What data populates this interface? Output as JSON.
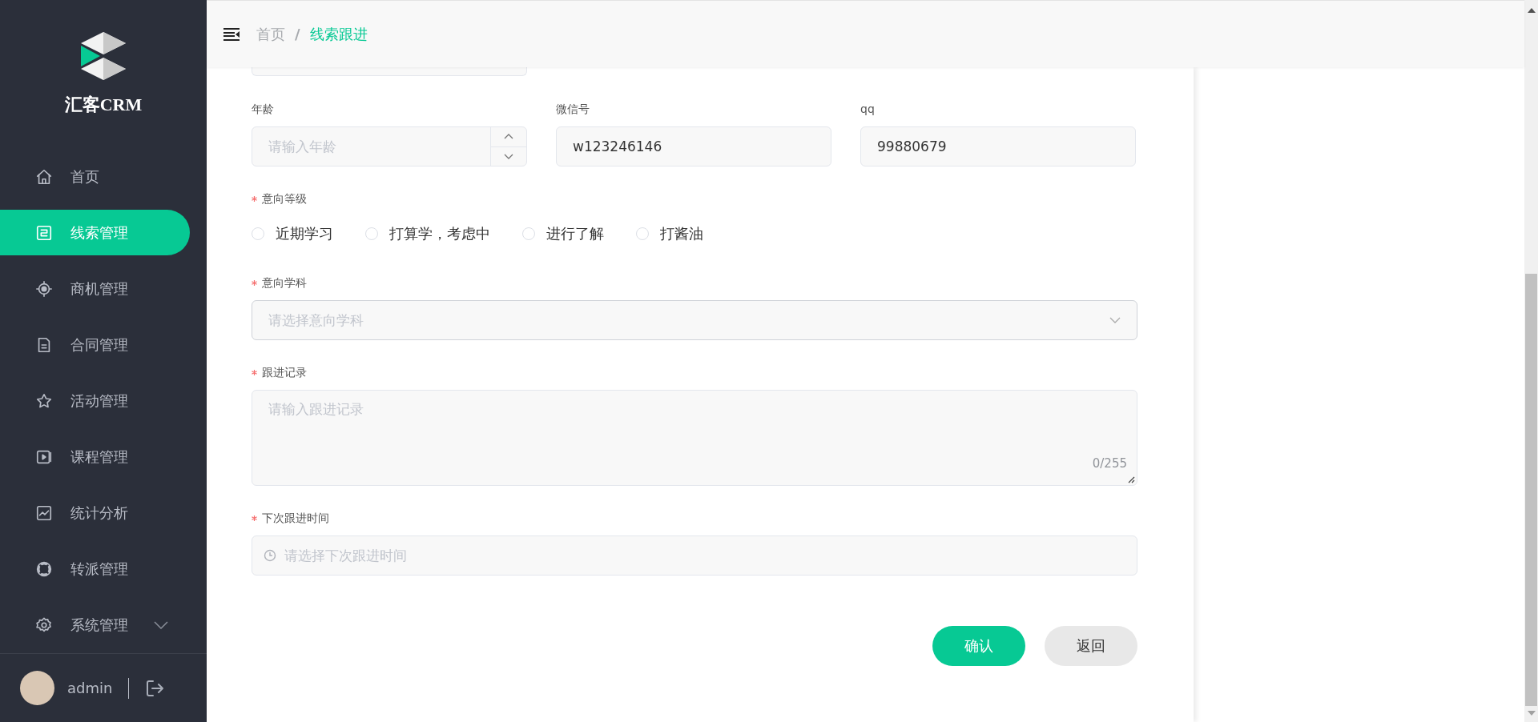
{
  "sidebar": {
    "brand": "汇客CRM",
    "items": [
      {
        "label": "首页",
        "kind": "link",
        "selected": false
      },
      {
        "label": "线索管理",
        "kind": "link",
        "selected": true
      },
      {
        "label": "商机管理",
        "kind": "link",
        "selected": false
      },
      {
        "label": "合同管理",
        "kind": "link",
        "selected": false
      },
      {
        "label": "活动管理",
        "kind": "link",
        "selected": false
      },
      {
        "label": "课程管理",
        "kind": "link",
        "selected": false
      },
      {
        "label": "统计分析",
        "kind": "link",
        "selected": false
      },
      {
        "label": "转派管理",
        "kind": "link",
        "selected": false
      },
      {
        "label": "系统管理",
        "kind": "group",
        "selected": false,
        "expanded": false
      }
    ],
    "user": {
      "name": "admin"
    }
  },
  "breadcrumb": {
    "separator": "/",
    "items": [
      {
        "label": "首页",
        "current": false
      },
      {
        "label": "线索跟进",
        "current": true
      }
    ]
  },
  "form": {
    "rows": [
      [
        {
          "kind": "number",
          "label": "年龄",
          "required": false,
          "placeholder": "请输入年龄"
        },
        {
          "kind": "text",
          "label": "微信号",
          "required": false,
          "value": "w123246146"
        },
        {
          "kind": "text",
          "label": "qq",
          "required": false,
          "value": "99880679"
        }
      ],
      [
        {
          "kind": "radio",
          "label": "意向等级",
          "required": true,
          "options": [
            {
              "label": "近期学习",
              "selected": false
            },
            {
              "label": "打算学，考虑中",
              "selected": false
            },
            {
              "label": "进行了解",
              "selected": false
            },
            {
              "label": "打酱油",
              "selected": false
            }
          ]
        }
      ],
      [
        {
          "kind": "select",
          "label": "意向学科",
          "required": true,
          "placeholder": "请选择意向学科"
        }
      ],
      [
        {
          "kind": "textarea",
          "label": "跟进记录",
          "required": true,
          "placeholder": "请输入跟进记录",
          "counter": "0/255"
        }
      ],
      [
        {
          "kind": "datetime",
          "label": "下次跟进时间",
          "required": true,
          "placeholder": "请选择下次跟进时间"
        }
      ]
    ],
    "buttons": [
      {
        "label": "确认",
        "kind": "primary"
      },
      {
        "label": "返回",
        "kind": "default"
      }
    ]
  }
}
